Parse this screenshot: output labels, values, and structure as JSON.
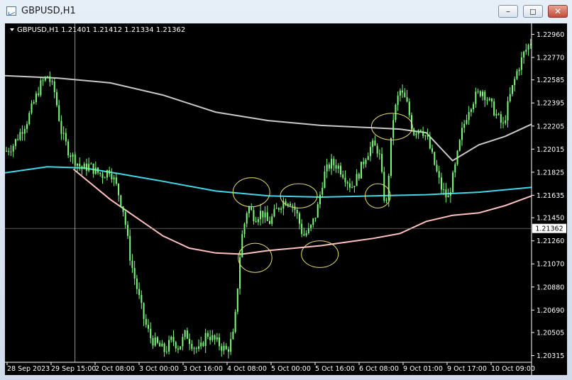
{
  "window": {
    "title": "GBPUSD,H1",
    "controls": {
      "minimize": "–",
      "restore": "◻",
      "close": "✕"
    }
  },
  "chart_data": {
    "type": "candlestick",
    "header": "GBPUSD,H1  1.21401 1.21412 1.21334 1.21362",
    "current_price_label": "1.21362",
    "current_price": 1.21362,
    "ylim": [
      1.2026,
      1.2305
    ],
    "y_ticks": [
      "1.22960",
      "1.22770",
      "1.22585",
      "1.22395",
      "1.22205",
      "1.22015",
      "1.21825",
      "1.21635",
      "1.21450",
      "1.21260",
      "1.21070",
      "1.20880",
      "1.20690",
      "1.20505",
      "1.20315"
    ],
    "x_ticks": [
      "28 Sep 2023",
      "29 Sep 15:00",
      "2 Oct 08:00",
      "3 Oct 00:00",
      "3 Oct 16:00",
      "4 Oct 08:00",
      "5 Oct 00:00",
      "5 Oct 16:00",
      "6 Oct 08:00",
      "9 Oct 01:00",
      "9 Oct 17:00",
      "10 Oct 09:00"
    ],
    "colors": {
      "background": "#000000",
      "candle": "#7CFC7C",
      "ma_slow": "#c8c8c8",
      "ma_mid": "#40d8e8",
      "ma_fast": "#ffc0c0",
      "annotation": "#e8e070"
    },
    "close_path": [
      1.22,
      1.2205,
      1.2215,
      1.2225,
      1.224,
      1.2255,
      1.2262,
      1.2248,
      1.2215,
      1.22,
      1.2192,
      1.2185,
      1.2188,
      1.2183,
      1.218,
      1.2185,
      1.217,
      1.215,
      1.211,
      1.2085,
      1.206,
      1.2045,
      1.204,
      1.2035,
      1.2045,
      1.2038,
      1.205,
      1.204,
      1.2035,
      1.205,
      1.2045,
      1.204,
      1.2035,
      1.205,
      1.2125,
      1.2155,
      1.2145,
      1.215,
      1.214,
      1.215,
      1.2158,
      1.216,
      1.215,
      1.213,
      1.2135,
      1.215,
      1.218,
      1.219,
      1.2188,
      1.218,
      1.217,
      1.218,
      1.2195,
      1.2205,
      1.22,
      1.215,
      1.2225,
      1.225,
      1.224,
      1.2215,
      1.222,
      1.221,
      1.219,
      1.217,
      1.216,
      1.2185,
      1.2215,
      1.2235,
      1.2245,
      1.225,
      1.224,
      1.223,
      1.222,
      1.2245,
      1.2265,
      1.228,
      1.229
    ],
    "ma_slow": [
      [
        0,
        1.2262
      ],
      [
        0.1,
        1.226
      ],
      [
        0.2,
        1.2256
      ],
      [
        0.3,
        1.2246
      ],
      [
        0.4,
        1.2232
      ],
      [
        0.5,
        1.2225
      ],
      [
        0.6,
        1.2221
      ],
      [
        0.7,
        1.2219
      ],
      [
        0.75,
        1.2218
      ],
      [
        0.8,
        1.2215
      ],
      [
        0.85,
        1.2192
      ],
      [
        0.9,
        1.2205
      ],
      [
        0.95,
        1.2212
      ],
      [
        1.0,
        1.2222
      ]
    ],
    "ma_mid": [
      [
        0,
        1.2182
      ],
      [
        0.08,
        1.2187
      ],
      [
        0.15,
        1.2186
      ],
      [
        0.22,
        1.2181
      ],
      [
        0.3,
        1.2175
      ],
      [
        0.4,
        1.2167
      ],
      [
        0.5,
        1.2163
      ],
      [
        0.6,
        1.2162
      ],
      [
        0.7,
        1.2163
      ],
      [
        0.8,
        1.2164
      ],
      [
        0.9,
        1.2166
      ],
      [
        1.0,
        1.217
      ]
    ],
    "ma_fast": [
      [
        0.13,
        1.2185
      ],
      [
        0.2,
        1.216
      ],
      [
        0.25,
        1.2145
      ],
      [
        0.3,
        1.213
      ],
      [
        0.35,
        1.212
      ],
      [
        0.4,
        1.2116
      ],
      [
        0.45,
        1.2115
      ],
      [
        0.5,
        1.2118
      ],
      [
        0.55,
        1.212
      ],
      [
        0.6,
        1.2122
      ],
      [
        0.65,
        1.2125
      ],
      [
        0.7,
        1.2128
      ],
      [
        0.75,
        1.2132
      ],
      [
        0.8,
        1.2142
      ],
      [
        0.85,
        1.2147
      ],
      [
        0.9,
        1.2149
      ],
      [
        0.95,
        1.2155
      ],
      [
        1.0,
        1.2163
      ]
    ],
    "annotations": [
      {
        "x": 0.468,
        "y": 1.2166,
        "rx": 0.035,
        "ry": 0.0012
      },
      {
        "x": 0.475,
        "y": 1.2112,
        "rx": 0.032,
        "ry": 0.0012
      },
      {
        "x": 0.558,
        "y": 1.2163,
        "rx": 0.035,
        "ry": 0.001
      },
      {
        "x": 0.598,
        "y": 1.2115,
        "rx": 0.035,
        "ry": 0.0011
      },
      {
        "x": 0.708,
        "y": 1.2163,
        "rx": 0.024,
        "ry": 0.001
      },
      {
        "x": 0.735,
        "y": 1.222,
        "rx": 0.039,
        "ry": 0.0011
      }
    ],
    "crosshair_x": 0.133
  }
}
